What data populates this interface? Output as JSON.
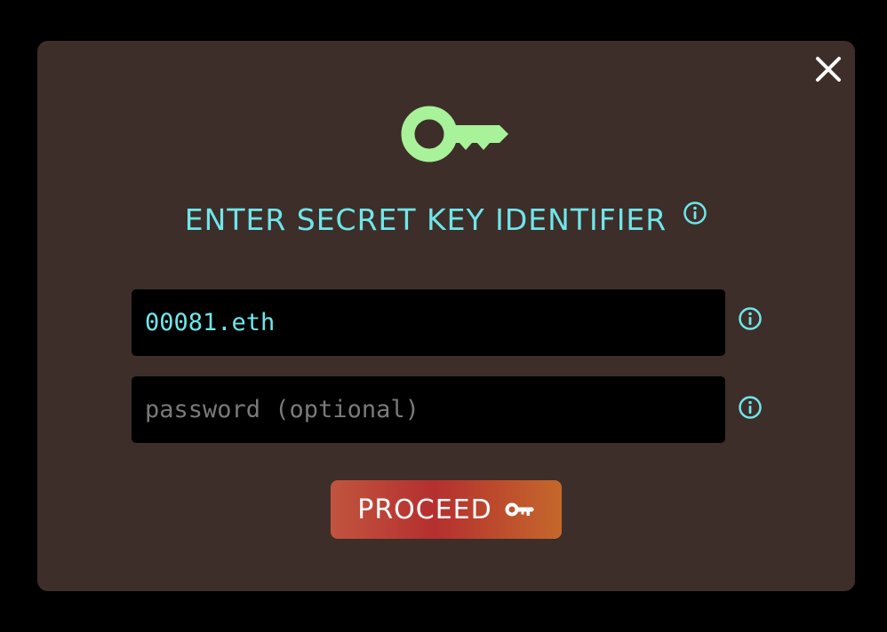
{
  "dialog": {
    "title": "ENTER SECRET KEY IDENTIFIER",
    "identifier_value": "00081.eth",
    "password_value": "",
    "password_placeholder": "password (optional)",
    "proceed_label": "PROCEED"
  },
  "icons": {
    "close": "close-icon",
    "hero": "key-icon",
    "info": "info-icon",
    "proceed": "key-icon"
  },
  "colors": {
    "background": "#000000",
    "dialog_background": "#3d2e29",
    "accent_cyan": "#6fe6ea",
    "key_green": "#a8f29a",
    "input_background": "#000000",
    "placeholder": "#7a7a7a",
    "button_gradient": [
      "#c1553e",
      "#b52f2f",
      "#c4682b"
    ]
  }
}
